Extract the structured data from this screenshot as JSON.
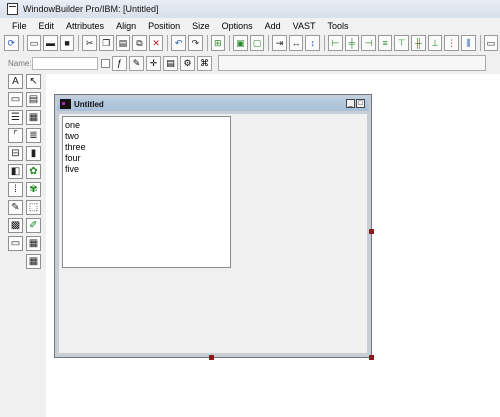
{
  "window": {
    "title": "WindowBuilder Pro/IBM: [Untitled]"
  },
  "menu": {
    "items": [
      "File",
      "Edit",
      "Attributes",
      "Align",
      "Position",
      "Size",
      "Options",
      "Add",
      "VAST",
      "Tools"
    ]
  },
  "namebar": {
    "label": "Name:",
    "value": ""
  },
  "design_window": {
    "title": "Untitled",
    "listbox_items": [
      "one",
      "two",
      "three",
      "four",
      "five"
    ]
  },
  "palette": {
    "button_a_glyph": "A"
  },
  "colors": {
    "selection_handle": "#8b1a1a",
    "title_gradient": "#a7bfd8"
  }
}
